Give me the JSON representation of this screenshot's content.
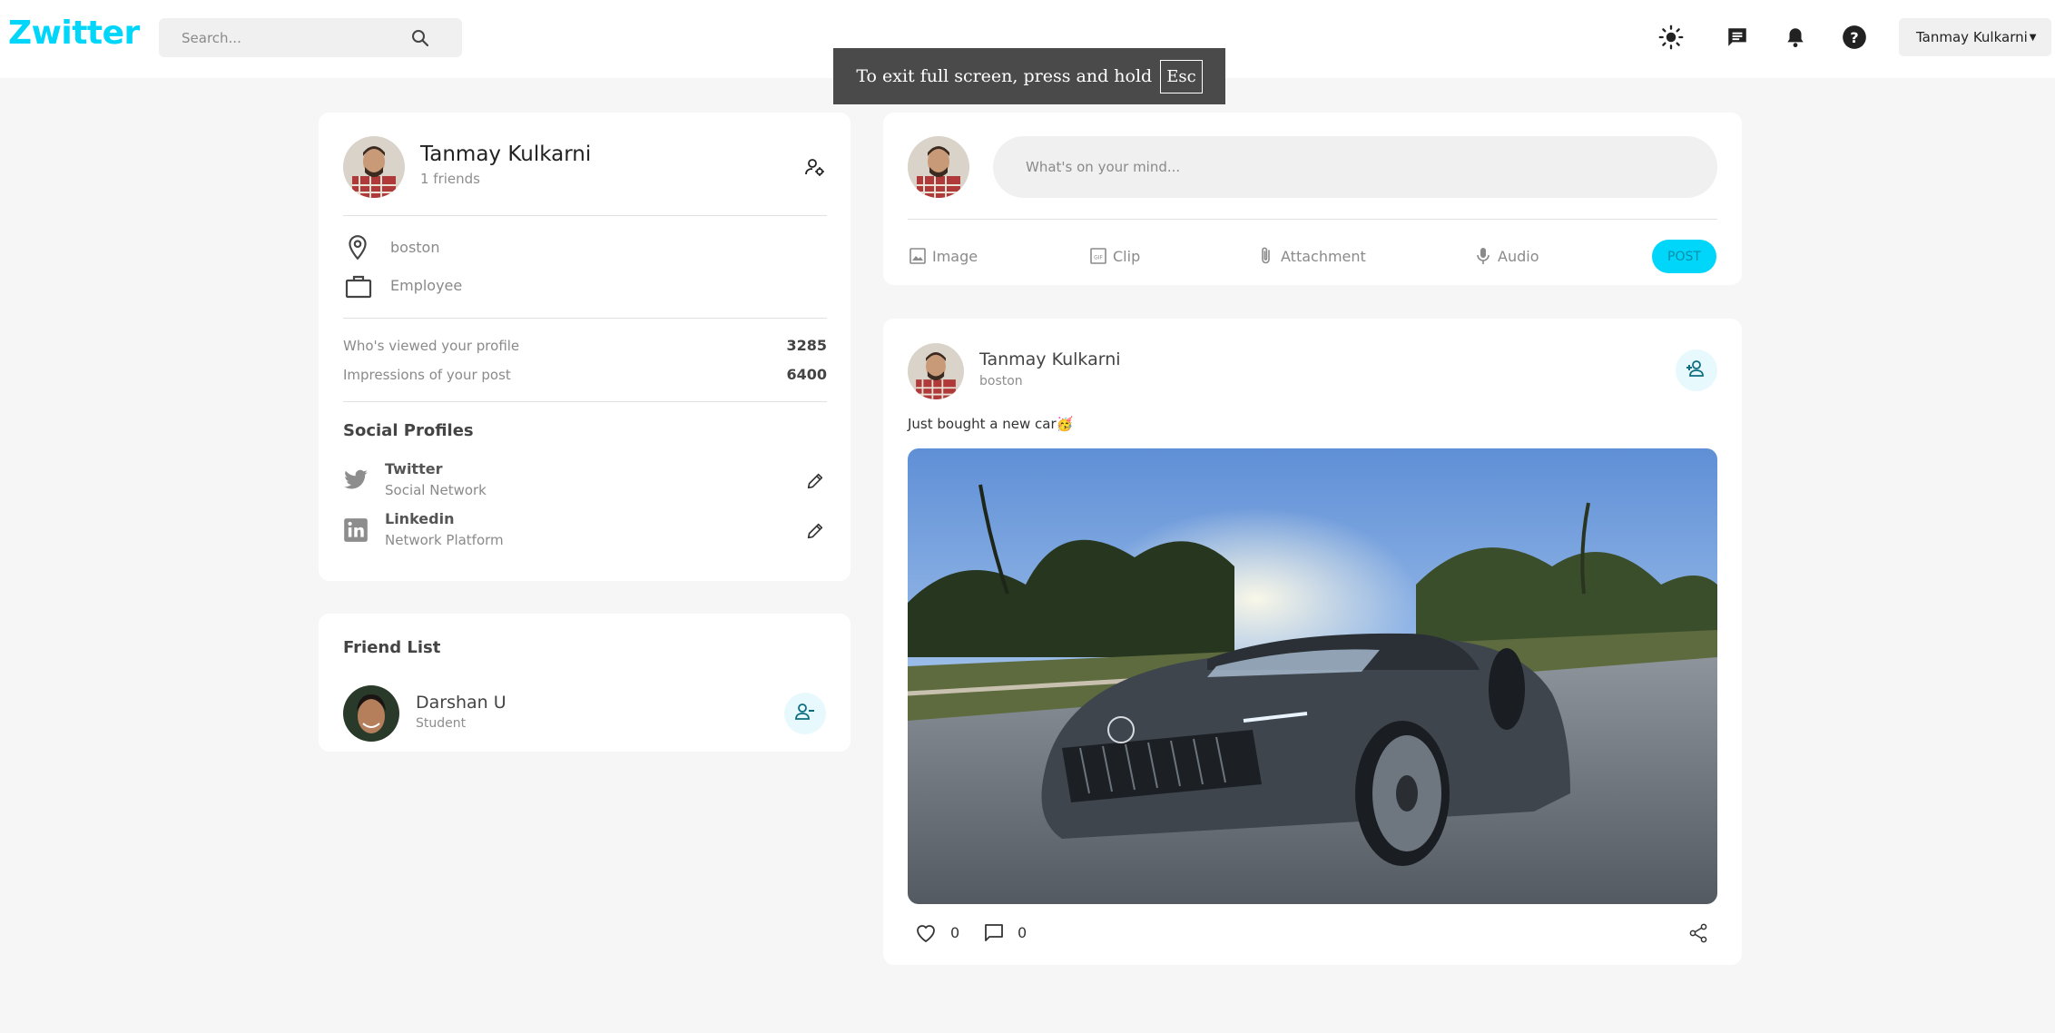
{
  "header": {
    "logo": "Zwitter",
    "search_placeholder": "Search...",
    "user_name": "Tanmay Kulkarni",
    "icons": [
      "search-icon",
      "sun-icon",
      "chat-icon",
      "bell-icon",
      "help-icon",
      "chevron-down-icon"
    ]
  },
  "toast": {
    "text": "To exit full screen, press and hold",
    "key": "Esc"
  },
  "profile": {
    "name": "Tanmay Kulkarni",
    "friends": "1 friends",
    "location": "boston",
    "occupation": "Employee",
    "stats": [
      {
        "label": "Who's viewed your profile",
        "value": "3285"
      },
      {
        "label": "Impressions of your post",
        "value": "6400"
      }
    ],
    "social_title": "Social Profiles",
    "socials": [
      {
        "name": "Twitter",
        "sub": "Social Network",
        "icon": "twitter-icon"
      },
      {
        "name": "Linkedin",
        "sub": "Network Platform",
        "icon": "linkedin-icon"
      }
    ]
  },
  "friends": {
    "title": "Friend List",
    "items": [
      {
        "name": "Darshan U",
        "sub": "Student"
      }
    ]
  },
  "composer": {
    "placeholder": "What's on your mind...",
    "actions": [
      "Image",
      "Clip",
      "Attachment",
      "Audio"
    ],
    "post_label": "POST"
  },
  "post": {
    "author": "Tanmay Kulkarni",
    "location": "boston",
    "text": "Just bought a new car🥳",
    "likes": "0",
    "comments": "0"
  },
  "colors": {
    "brand": "#00d5fa",
    "background": "#f6f6f6",
    "card": "#ffffff"
  }
}
